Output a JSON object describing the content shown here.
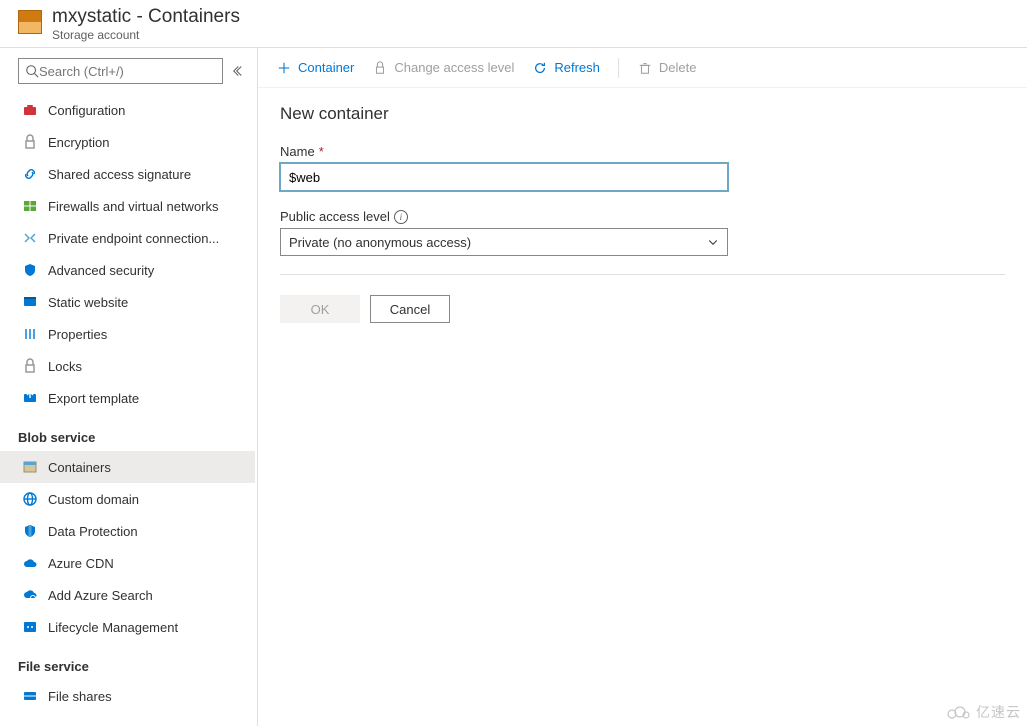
{
  "header": {
    "title": "mxystatic - Containers",
    "subtitle": "Storage account"
  },
  "search": {
    "placeholder": "Search (Ctrl+/)"
  },
  "nav": {
    "items_top": [
      {
        "icon": "briefcase",
        "color": "#d13438",
        "label": "Configuration"
      },
      {
        "icon": "lock",
        "color": "#959392",
        "label": "Encryption"
      },
      {
        "icon": "link",
        "color": "#0078d4",
        "label": "Shared access signature"
      },
      {
        "icon": "firewall",
        "color": "#5aa938",
        "label": "Firewalls and virtual networks"
      },
      {
        "icon": "endpoint",
        "color": "#4aa4d4",
        "label": "Private endpoint connection..."
      },
      {
        "icon": "shield",
        "color": "#0078d4",
        "label": "Advanced security"
      },
      {
        "icon": "website",
        "color": "#0078d4",
        "label": "Static website"
      },
      {
        "icon": "sliders",
        "color": "#0078d4",
        "label": "Properties"
      },
      {
        "icon": "lock",
        "color": "#959392",
        "label": "Locks"
      },
      {
        "icon": "export",
        "color": "#0078d4",
        "label": "Export template"
      }
    ],
    "group_blob": "Blob service",
    "items_blob": [
      {
        "icon": "container",
        "color": "#9c8e63",
        "label": "Containers",
        "active": true
      },
      {
        "icon": "globe",
        "color": "#0078d4",
        "label": "Custom domain"
      },
      {
        "icon": "shield2",
        "color": "#0078d4",
        "label": "Data Protection"
      },
      {
        "icon": "cloud",
        "color": "#0078d4",
        "label": "Azure CDN"
      },
      {
        "icon": "search-cloud",
        "color": "#0078d4",
        "label": "Add Azure Search"
      },
      {
        "icon": "lifecycle",
        "color": "#0078d4",
        "label": "Lifecycle Management"
      }
    ],
    "group_file": "File service",
    "items_file": [
      {
        "icon": "fileshare",
        "color": "#0078d4",
        "label": "File shares"
      }
    ]
  },
  "cmdbar": {
    "container": "Container",
    "change_access": "Change access level",
    "refresh": "Refresh",
    "delete": "Delete"
  },
  "panel": {
    "title": "New container",
    "name_label": "Name",
    "name_value": "$web",
    "pal_label": "Public access level",
    "pal_value": "Private (no anonymous access)",
    "ok": "OK",
    "cancel": "Cancel"
  },
  "watermark": "亿速云"
}
